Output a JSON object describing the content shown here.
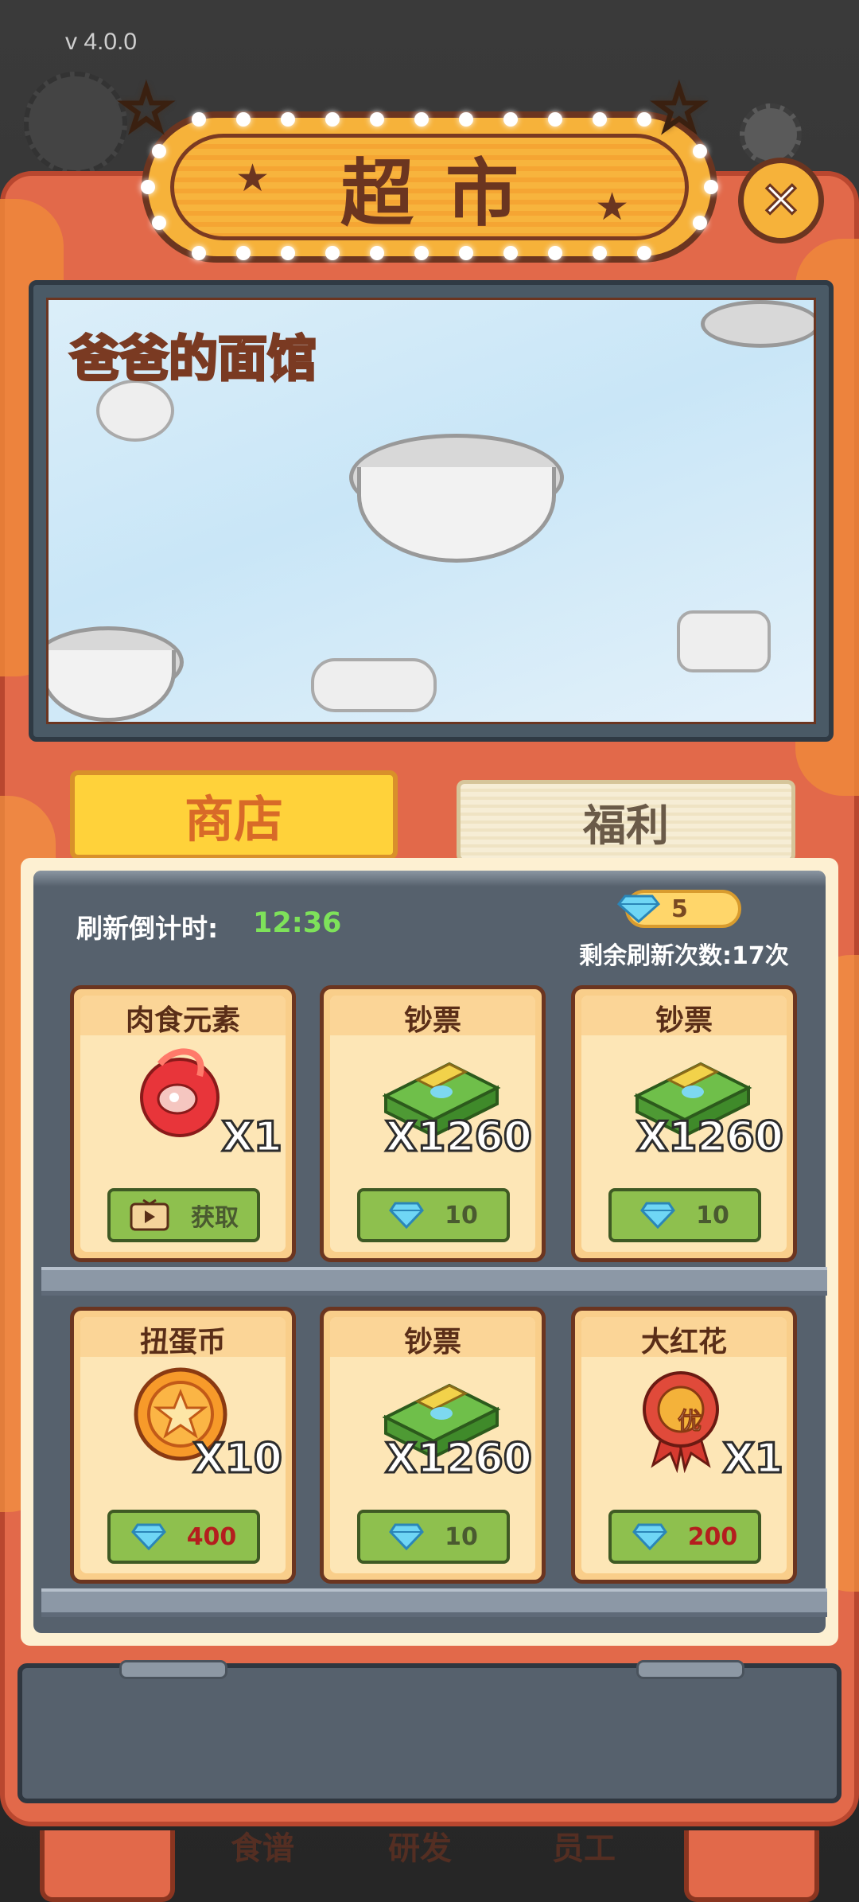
{
  "version": "v  4.0.0",
  "header": {
    "title": "超市",
    "close_icon": "close-icon"
  },
  "banner": {
    "logo_text": "爸爸的面馆"
  },
  "tabs": [
    {
      "label": "商店",
      "active": true
    },
    {
      "label": "福利",
      "active": false
    }
  ],
  "shop": {
    "refresh_label": "刷新倒计时:",
    "refresh_time": "12:36",
    "gems": "5",
    "refresh_count_label": "剩余刷新次数:17次"
  },
  "items": [
    {
      "title": "肉食元素",
      "qty": "X1",
      "icon": "meat-element-icon",
      "button": {
        "type": "video",
        "label": "获取"
      }
    },
    {
      "title": "钞票",
      "qty": "X1260",
      "icon": "cash-stack-icon",
      "button": {
        "type": "gem",
        "price": "10"
      }
    },
    {
      "title": "钞票",
      "qty": "X1260",
      "icon": "cash-stack-icon",
      "button": {
        "type": "gem",
        "price": "10"
      }
    },
    {
      "title": "扭蛋币",
      "qty": "X10",
      "icon": "gacha-coin-icon",
      "button": {
        "type": "gem",
        "price": "400"
      }
    },
    {
      "title": "钞票",
      "qty": "X1260",
      "icon": "cash-stack-icon",
      "button": {
        "type": "gem",
        "price": "10"
      }
    },
    {
      "title": "大红花",
      "qty": "X1",
      "icon": "red-flower-badge-icon",
      "button": {
        "type": "gem",
        "price": "200"
      }
    }
  ],
  "badge_text": "优",
  "bottom_nav": [
    "食谱",
    "研发",
    "员工"
  ],
  "colors": {
    "frame": "#e2694a",
    "accent": "#ffd23a",
    "shelf": "#56616d",
    "price_red": "#b41e1e",
    "timer_green": "#7ee25a"
  }
}
